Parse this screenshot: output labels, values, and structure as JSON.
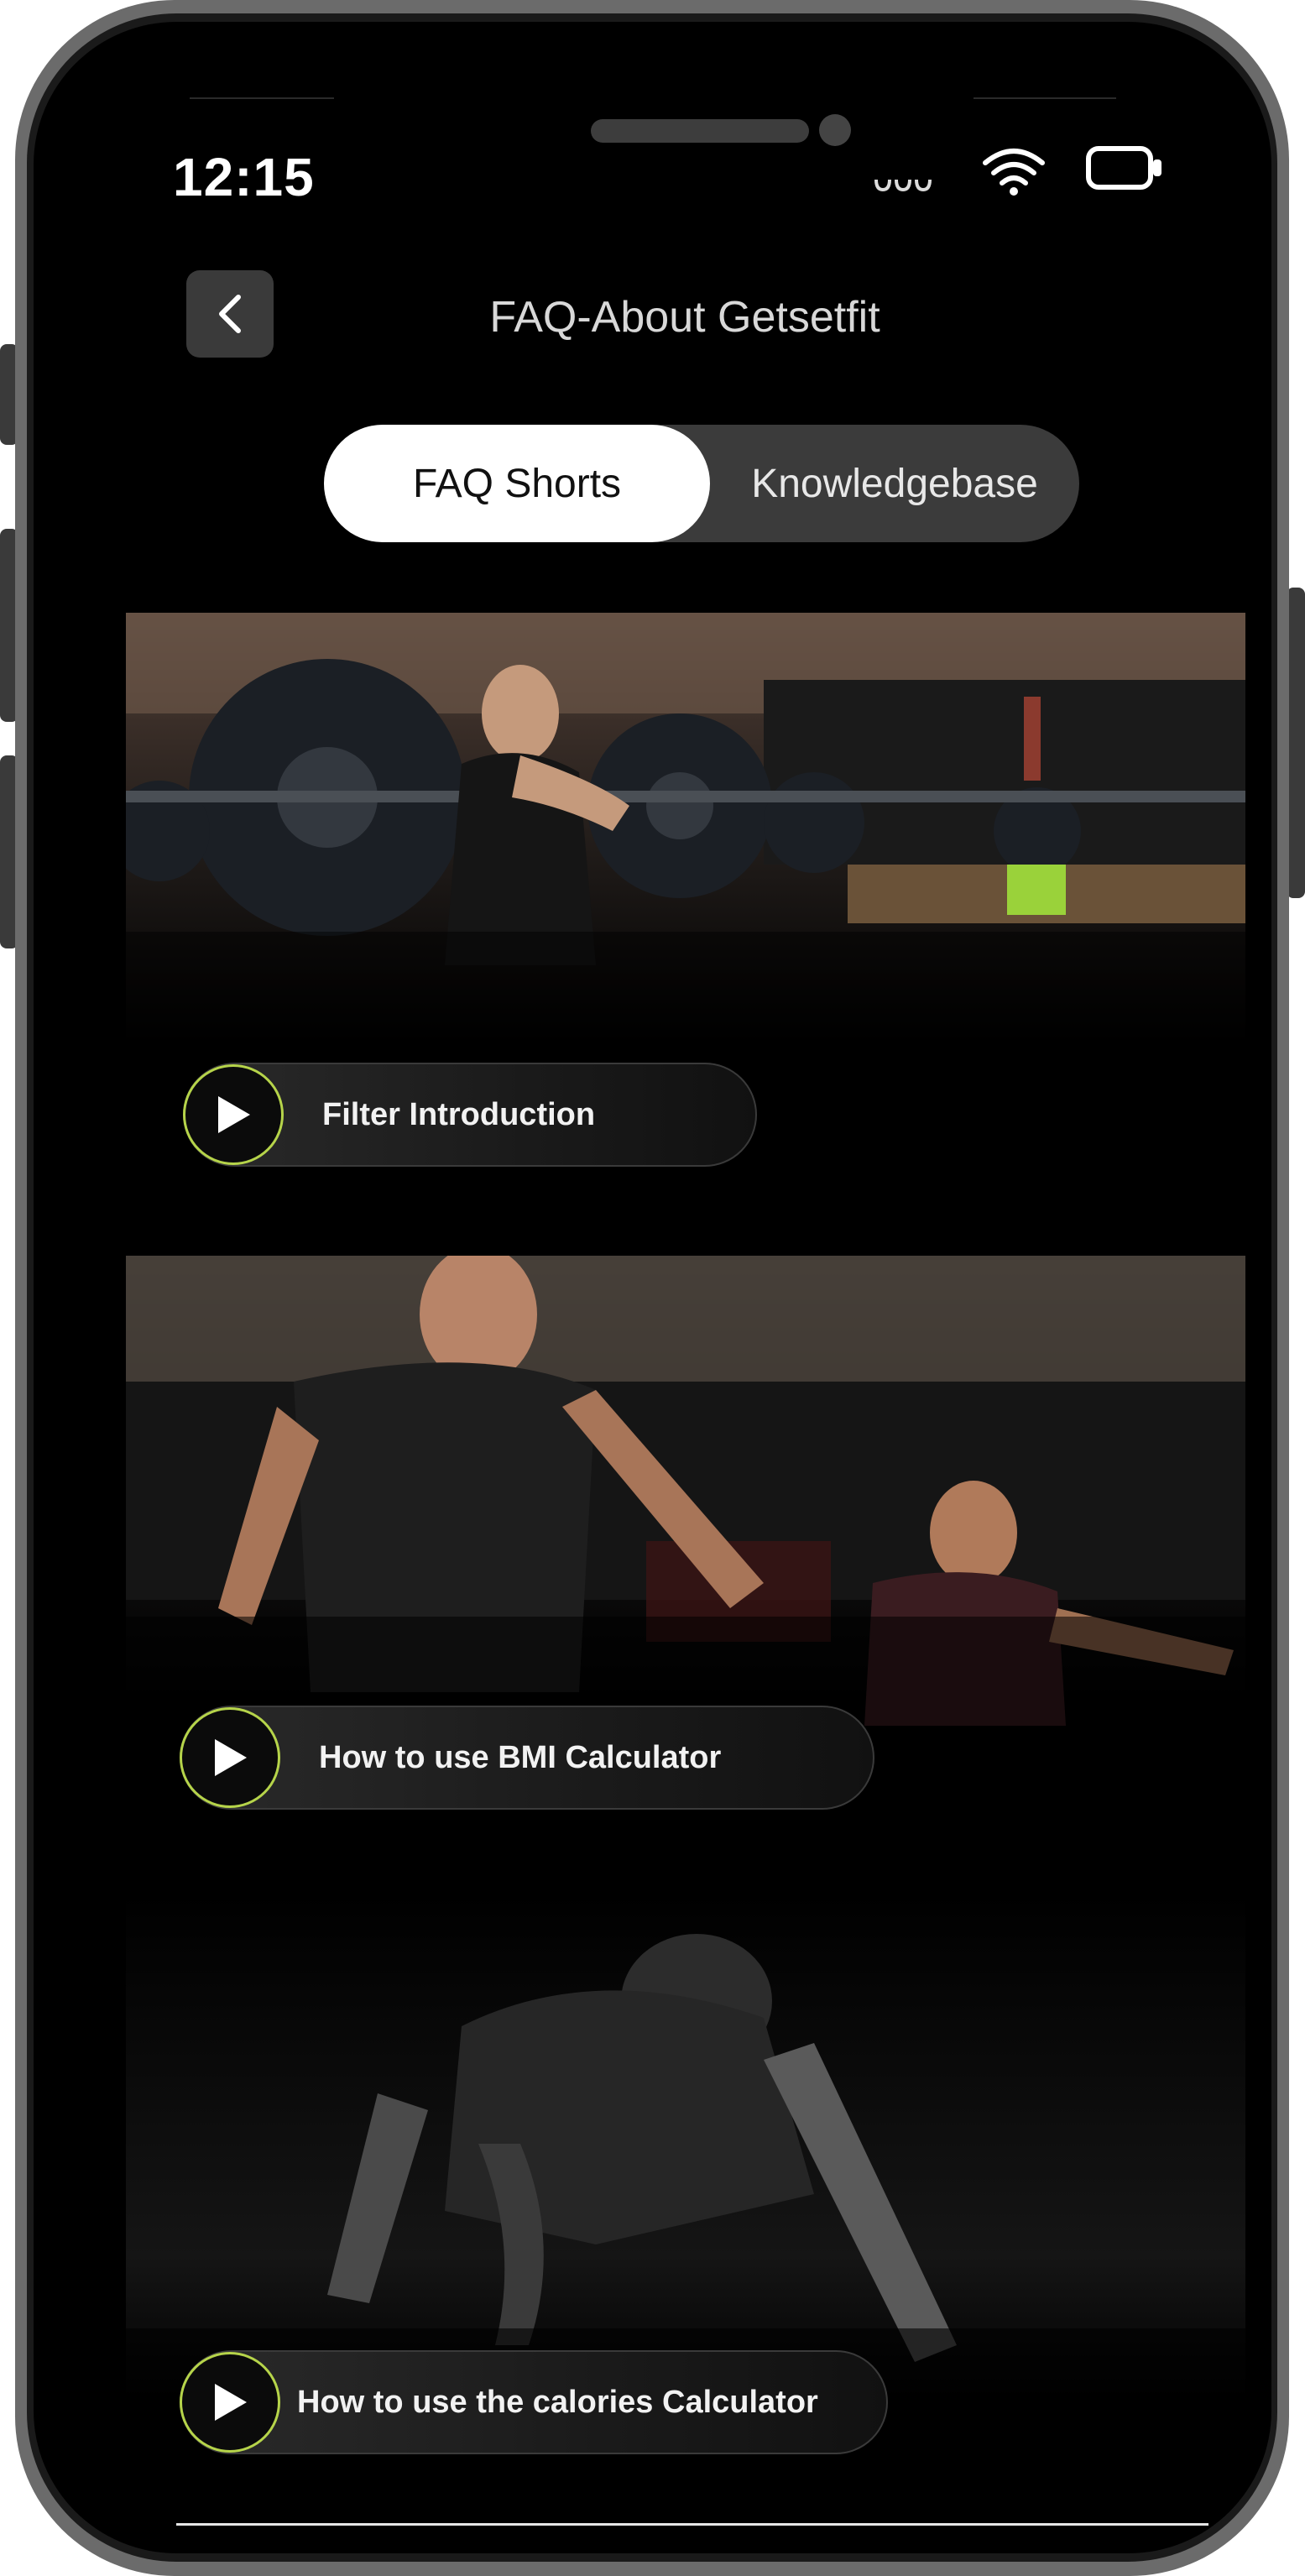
{
  "status_bar": {
    "time": "12:15",
    "icons": [
      "signal-icon",
      "wifi-icon",
      "battery-icon"
    ]
  },
  "header": {
    "back_icon": "chevron-left-icon",
    "title": "FAQ-About Getsetfit"
  },
  "tabs": {
    "active": "FAQ Shorts",
    "items": [
      {
        "label": "FAQ Shorts"
      },
      {
        "label": "Knowledgebase"
      }
    ]
  },
  "videos": [
    {
      "title": "Filter Introduction",
      "icon": "play-icon"
    },
    {
      "title": "How to use BMI Calculator",
      "icon": "play-icon"
    },
    {
      "title": "How to use the calories Calculator",
      "icon": "play-icon"
    }
  ],
  "colors": {
    "accent": "#b6d44a",
    "background": "#000000",
    "tab_active_bg": "#ffffff",
    "tab_inactive_bg": "#3b3b3b"
  }
}
